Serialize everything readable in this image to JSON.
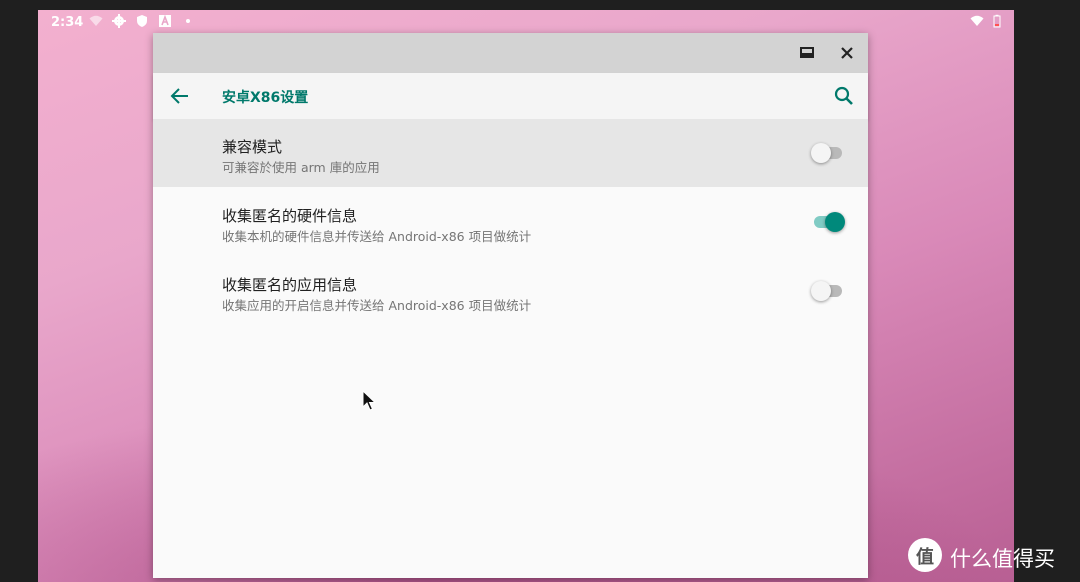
{
  "status_bar": {
    "time": "2:34",
    "icons": [
      "wifi-icon",
      "gear-icon",
      "shield-icon",
      "a-icon",
      "dot-icon"
    ],
    "right_icons": [
      "wifi-icon",
      "battery-icon"
    ]
  },
  "window": {
    "controls": [
      "maximize-icon",
      "close-icon"
    ],
    "app_bar": {
      "title": "安卓X86设置",
      "accent_color": "#00796b"
    },
    "settings": [
      {
        "title": "兼容模式",
        "summary": "可兼容於使用 arm 庫的应用",
        "enabled": false,
        "selected": true
      },
      {
        "title": "收集匿名的硬件信息",
        "summary": "收集本机的硬件信息并传送给 Android-x86 项目做统计",
        "enabled": true,
        "selected": false
      },
      {
        "title": "收集匿名的应用信息",
        "summary": "收集应用的开启信息并传送给 Android-x86 项目做统计",
        "enabled": false,
        "selected": false
      }
    ]
  },
  "watermark": {
    "logo_char": "值",
    "text": "什么值得买"
  }
}
